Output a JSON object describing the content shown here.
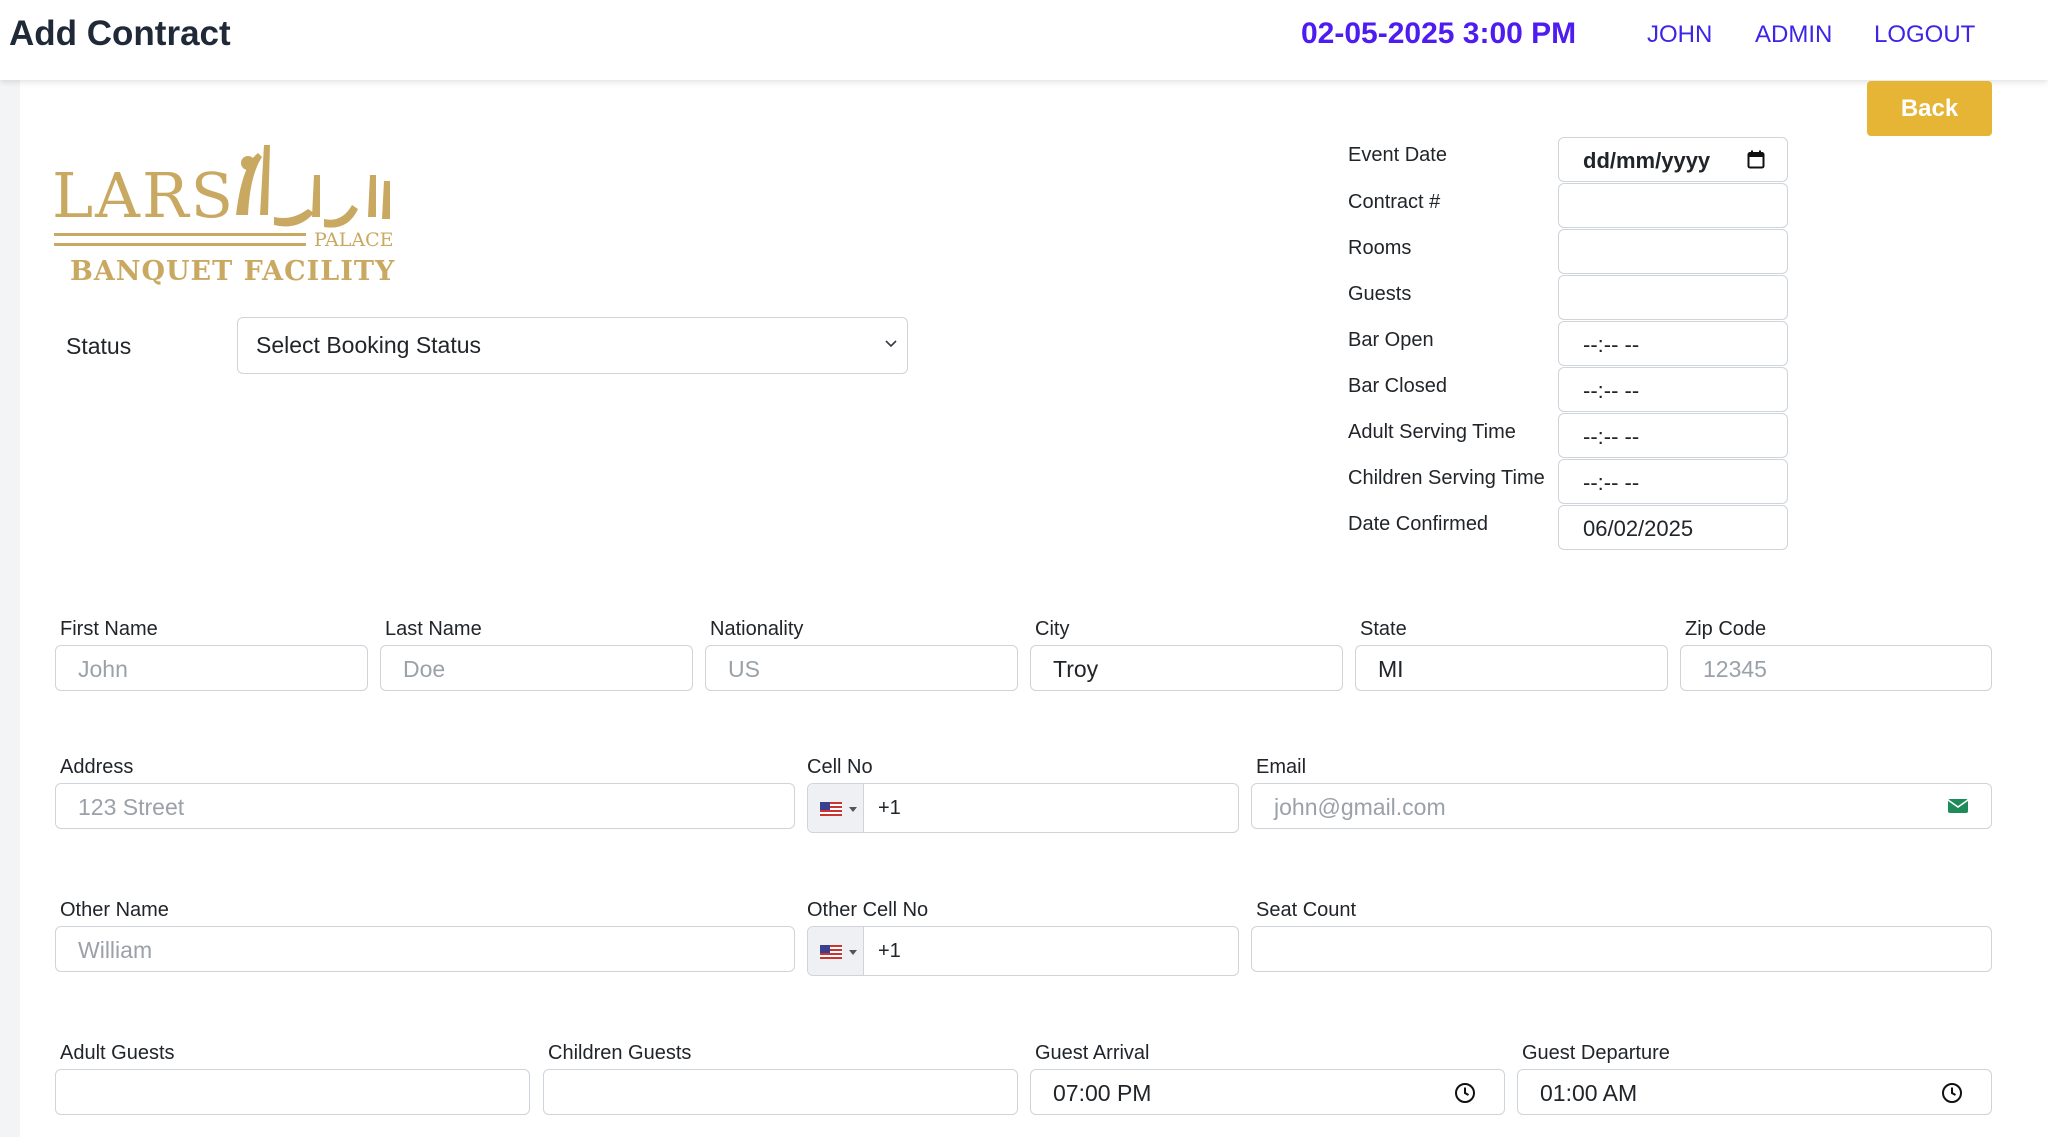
{
  "header": {
    "title": "Add Contract",
    "datetime": "02-05-2025 3:00 PM",
    "nav": [
      "JOHN",
      "ADMIN",
      "LOGOUT"
    ]
  },
  "actions": {
    "back_label": "Back"
  },
  "logo": {
    "name": "LARSA PALACE",
    "sub": "BANQUET FACILITY"
  },
  "status": {
    "label": "Status",
    "selected": "Select Booking Status"
  },
  "event": [
    {
      "label": "Event Date",
      "value": "dd/mm/yyyy"
    },
    {
      "label": "Contract #",
      "value": ""
    },
    {
      "label": "Rooms",
      "value": ""
    },
    {
      "label": "Guests",
      "value": ""
    },
    {
      "label": "Bar Open",
      "value": "--:-- --"
    },
    {
      "label": "Bar Closed",
      "value": "--:-- --"
    },
    {
      "label": "Adult Serving Time",
      "value": "--:-- --"
    },
    {
      "label": "Children Serving Time",
      "value": "--:-- --"
    },
    {
      "label": "Date Confirmed",
      "value": "06/02/2025"
    }
  ],
  "customer": {
    "first_name": {
      "label": "First Name",
      "placeholder": "John"
    },
    "last_name": {
      "label": "Last Name",
      "placeholder": "Doe"
    },
    "nationality": {
      "label": "Nationality",
      "placeholder": "US"
    },
    "city": {
      "label": "City",
      "value": "Troy"
    },
    "state": {
      "label": "State",
      "value": "MI"
    },
    "zip": {
      "label": "Zip Code",
      "placeholder": "12345"
    },
    "address": {
      "label": "Address",
      "placeholder": "123 Street"
    },
    "cell": {
      "label": "Cell No",
      "dial": "+1"
    },
    "email": {
      "label": "Email",
      "placeholder": "john@gmail.com"
    },
    "other_name": {
      "label": "Other Name",
      "placeholder": "William"
    },
    "other_cell": {
      "label": "Other Cell No",
      "dial": "+1"
    },
    "seat_count": {
      "label": "Seat Count",
      "value": ""
    }
  },
  "guests": {
    "adult": {
      "label": "Adult Guests",
      "value": ""
    },
    "children": {
      "label": "Children Guests",
      "value": ""
    },
    "arrival": {
      "label": "Guest Arrival",
      "value": "07:00 PM"
    },
    "departure": {
      "label": "Guest Departure",
      "value": "01:00 AM"
    }
  },
  "colors": {
    "accent": "#4f1cf0",
    "nav_link": "#3d24e6",
    "back_button": "#e6b535",
    "logo_gold": "#c9a962"
  }
}
